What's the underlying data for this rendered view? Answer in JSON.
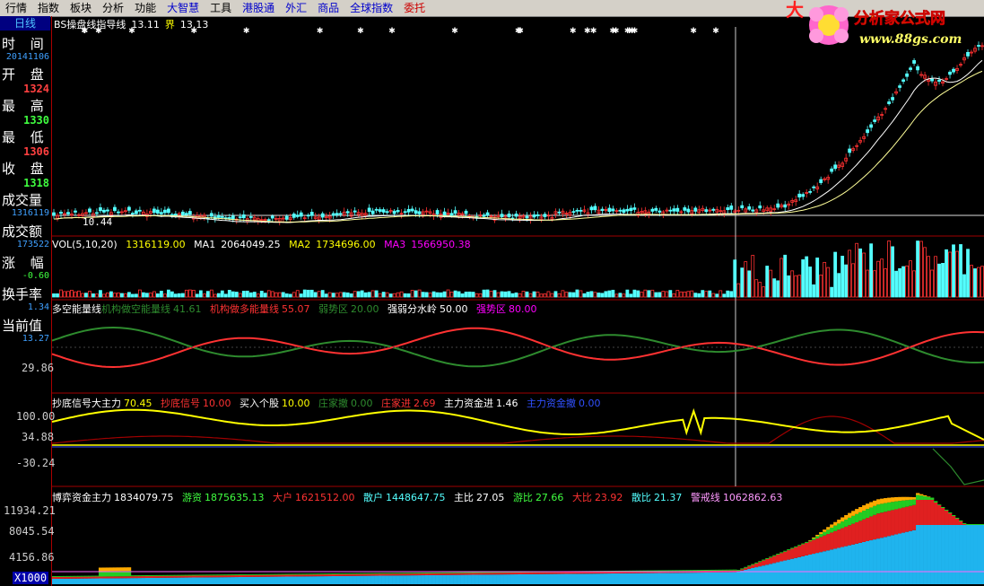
{
  "menu": [
    {
      "label": "行情",
      "color": "#000"
    },
    {
      "label": "指数",
      "color": "#000"
    },
    {
      "label": "板块",
      "color": "#000"
    },
    {
      "label": "分析",
      "color": "#000"
    },
    {
      "label": "功能",
      "color": "#000"
    },
    {
      "label": "大智慧",
      "color": "#0000cc"
    },
    {
      "label": "工具",
      "color": "#000"
    },
    {
      "label": "港股通",
      "color": "#0000cc"
    },
    {
      "label": "外汇",
      "color": "#0000cc"
    },
    {
      "label": "商品",
      "color": "#0000cc"
    },
    {
      "label": "全球指数",
      "color": "#0000cc"
    },
    {
      "label": "委托",
      "color": "#cc0000"
    }
  ],
  "logo": {
    "brand": "大",
    "name": "分析家公式网",
    "url": "www.88gs.com"
  },
  "period_tab": "日线",
  "left_panel": {
    "time_label": "时 间",
    "time_value": "20141106",
    "open_label": "开 盘",
    "open_value": "1324",
    "high_label": "最 高",
    "high_value": "1330",
    "low_label": "最 低",
    "low_value": "1306",
    "close_label": "收 盘",
    "close_value": "1318",
    "vol_label": "成交量",
    "vol_value": "1316119",
    "amount_label": "成交额",
    "amount_value": "173522",
    "change_label": "涨 幅",
    "change_value": "-0.60",
    "turnover_label": "换手率",
    "turnover_value": "1.34",
    "current_label": "当前值",
    "current_value": "13.27"
  },
  "main_chart": {
    "title": "BS操盘线指导线",
    "v1": "13.11",
    "marker": "界",
    "v2": "13.13",
    "low_mark": "10.44"
  },
  "vol_pane": {
    "name": "VOL(5,10,20)",
    "vol": "1316119.00",
    "ma1_label": "MA1",
    "ma1": "2064049.25",
    "ma2_label": "MA2",
    "ma2": "1734696.00",
    "ma3_label": "MA3",
    "ma3": "1566950.38"
  },
  "energy_pane": {
    "name": "多空能量线",
    "a_label": "机构做空能量线",
    "a_value": "41.61",
    "b_label": "机构做多能量线",
    "b_value": "55.07",
    "c_label": "弱势区",
    "c_value": "20.00",
    "d_label": "强弱分水岭",
    "d_value": "50.00",
    "e_label": "强势区",
    "e_value": "80.00",
    "axis_value": "29.86"
  },
  "signal_pane": {
    "name": "抄底信号大主力",
    "name_value": "70.45",
    "a_label": "抄底信号",
    "a_value": "10.00",
    "b_label": "买入个股",
    "b_value": "10.00",
    "c_label": "庄家撤",
    "c_value": "0.00",
    "d_label": "庄家进",
    "d_value": "2.69",
    "e_label": "主力资金进",
    "e_value": "1.46",
    "f_label": "主力资金撤",
    "f_value": "0.00",
    "axis_top": "100.00",
    "axis_mid": "34.88",
    "axis_low": "-30.24"
  },
  "fund_pane": {
    "name": "博弈资金主力",
    "name_value": "1834079.75",
    "a_label": "游资",
    "a_value": "1875635.13",
    "b_label": "大户",
    "b_value": "1621512.00",
    "c_label": "散户",
    "c_value": "1448647.75",
    "d_label": "主比",
    "d_value": "27.05",
    "e_label": "游比",
    "e_value": "27.66",
    "f_label": "大比",
    "f_value": "23.92",
    "g_label": "散比",
    "g_value": "21.37",
    "h_label": "警戒线",
    "h_value": "1062862.63",
    "axis_top": "11934.21",
    "axis_mid": "8045.54",
    "axis_low": "4156.86",
    "unit": "X1000"
  },
  "colors": {
    "up": "#ff3232",
    "down": "#54ffff",
    "yellow": "#ffff00",
    "green": "#2e8b2e",
    "magenta": "#ff00ff",
    "grid": "#a00000"
  }
}
